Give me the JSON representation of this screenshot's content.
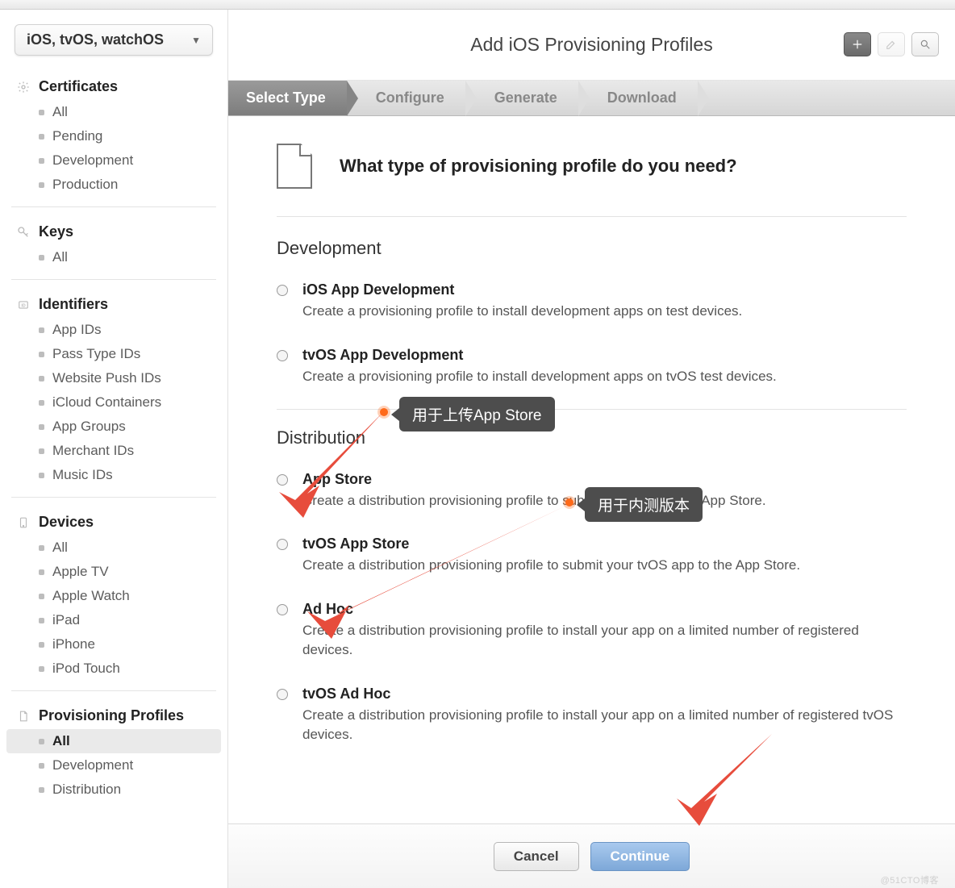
{
  "platformSelect": "iOS, tvOS, watchOS",
  "sidebar": {
    "sections": [
      {
        "icon": "gear",
        "title": "Certificates",
        "items": [
          {
            "label": "All"
          },
          {
            "label": "Pending"
          },
          {
            "label": "Development"
          },
          {
            "label": "Production"
          }
        ]
      },
      {
        "icon": "key",
        "title": "Keys",
        "items": [
          {
            "label": "All"
          }
        ]
      },
      {
        "icon": "id",
        "title": "Identifiers",
        "items": [
          {
            "label": "App IDs"
          },
          {
            "label": "Pass Type IDs"
          },
          {
            "label": "Website Push IDs"
          },
          {
            "label": "iCloud Containers"
          },
          {
            "label": "App Groups"
          },
          {
            "label": "Merchant IDs"
          },
          {
            "label": "Music IDs"
          }
        ]
      },
      {
        "icon": "device",
        "title": "Devices",
        "items": [
          {
            "label": "All"
          },
          {
            "label": "Apple TV"
          },
          {
            "label": "Apple Watch"
          },
          {
            "label": "iPad"
          },
          {
            "label": "iPhone"
          },
          {
            "label": "iPod Touch"
          }
        ]
      },
      {
        "icon": "doc",
        "title": "Provisioning Profiles",
        "items": [
          {
            "label": "All",
            "selected": true
          },
          {
            "label": "Development"
          },
          {
            "label": "Distribution"
          }
        ]
      }
    ]
  },
  "header": {
    "title": "Add iOS Provisioning Profiles"
  },
  "steps": [
    {
      "label": "Select Type",
      "active": true
    },
    {
      "label": "Configure"
    },
    {
      "label": "Generate"
    },
    {
      "label": "Download"
    }
  ],
  "question": "What type of provisioning profile do you need?",
  "groups": [
    {
      "title": "Development",
      "options": [
        {
          "label": "iOS App Development",
          "desc": "Create a provisioning profile to install development apps on test devices."
        },
        {
          "label": "tvOS App Development",
          "desc": "Create a provisioning profile to install development apps on tvOS test devices."
        }
      ]
    },
    {
      "title": "Distribution",
      "options": [
        {
          "label": "App Store",
          "desc": "Create a distribution provisioning profile to submit your app to the App Store."
        },
        {
          "label": "tvOS App Store",
          "desc": "Create a distribution provisioning profile to submit your tvOS app to the App Store."
        },
        {
          "label": "Ad Hoc",
          "desc": "Create a distribution provisioning profile to install your app on a limited number of registered devices."
        },
        {
          "label": "tvOS Ad Hoc",
          "desc": "Create a distribution provisioning profile to install your app on a limited number of registered tvOS devices."
        }
      ]
    }
  ],
  "footer": {
    "cancel": "Cancel",
    "continue": "Continue"
  },
  "annotations": {
    "tooltip1": "用于上传App Store",
    "tooltip2": "用于内测版本"
  },
  "watermark": "@51CTO博客"
}
